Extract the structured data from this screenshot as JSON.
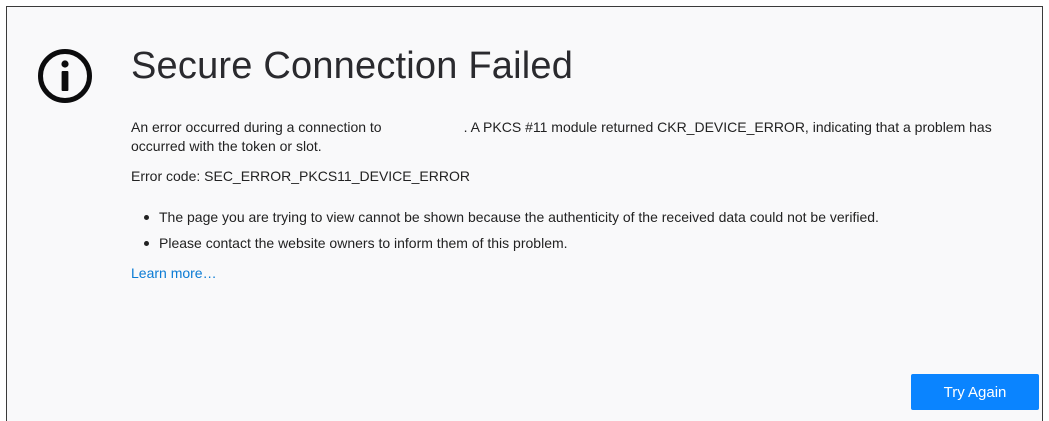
{
  "page": {
    "title": "Secure Connection Failed",
    "description_before_host": "An error occurred during a connection to",
    "description_after_host": ". A PKCS #11 module returned CKR_DEVICE_ERROR, indicating that a problem has occurred with the token or slot.",
    "error_code_line": "Error code: SEC_ERROR_PKCS11_DEVICE_ERROR",
    "bullets": [
      "The page you are trying to view cannot be shown because the authenticity of the received data could not be verified.",
      "Please contact the website owners to inform them of this problem."
    ],
    "learn_more_label": "Learn more…",
    "try_again_label": "Try Again"
  },
  "icons": {
    "error": "info-circle-icon"
  },
  "colors": {
    "background": "#f9f9fa",
    "text": "#222222",
    "title": "#2a2a2e",
    "link": "#0a7bd4",
    "button": "#0a84ff",
    "button_text": "#ffffff"
  }
}
